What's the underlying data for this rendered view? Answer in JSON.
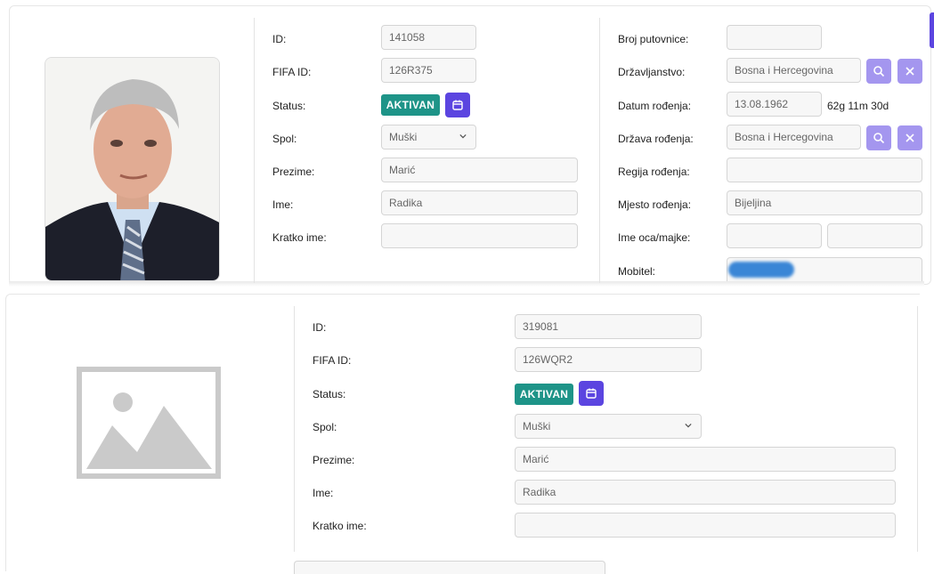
{
  "card1": {
    "labels": {
      "id": "ID:",
      "fifa_id": "FIFA ID:",
      "status": "Status:",
      "spol": "Spol:",
      "prezime": "Prezime:",
      "ime": "Ime:",
      "kratko_ime": "Kratko ime:",
      "broj_putovnice": "Broj putovnice:",
      "drzavljanstvo": "Državljanstvo:",
      "datum_rodjenja": "Datum rođenja:",
      "drzava_rodjenja": "Država rođenja:",
      "regija_rodjenja": "Regija rođenja:",
      "mjesto_rodjenja": "Mjesto rođenja:",
      "ime_oca_majke": "Ime oca/majke:",
      "mobitel": "Mobitel:"
    },
    "values": {
      "id": "141058",
      "fifa_id": "126R375",
      "status": "AKTIVAN",
      "spol": "Muški",
      "prezime": "Marić",
      "ime": "Radika",
      "kratko_ime": "",
      "broj_putovnice": "",
      "drzavljanstvo": "Bosna i Hercegovina",
      "datum_rodjenja": "13.08.1962",
      "age": "62g 11m 30d",
      "drzava_rodjenja": "Bosna i Hercegovina",
      "regija_rodjenja": "",
      "mjesto_rodjenja": "Bijeljina",
      "ime_oca": "",
      "ime_majke": ""
    }
  },
  "card2": {
    "labels": {
      "id": "ID:",
      "fifa_id": "FIFA ID:",
      "status": "Status:",
      "spol": "Spol:",
      "prezime": "Prezime:",
      "ime": "Ime:",
      "kratko_ime": "Kratko ime:"
    },
    "values": {
      "id": "319081",
      "fifa_id": "126WQR2",
      "status": "AKTIVAN",
      "spol": "Muški",
      "prezime": "Marić",
      "ime": "Radika",
      "kratko_ime": ""
    }
  },
  "colors": {
    "status_badge": "#1e9488",
    "calendar_button": "#5b45e0",
    "action_button": "#a496ef"
  },
  "icons": [
    "calendar-icon",
    "search-icon",
    "close-icon",
    "chevron-down-icon",
    "image-placeholder-icon"
  ]
}
